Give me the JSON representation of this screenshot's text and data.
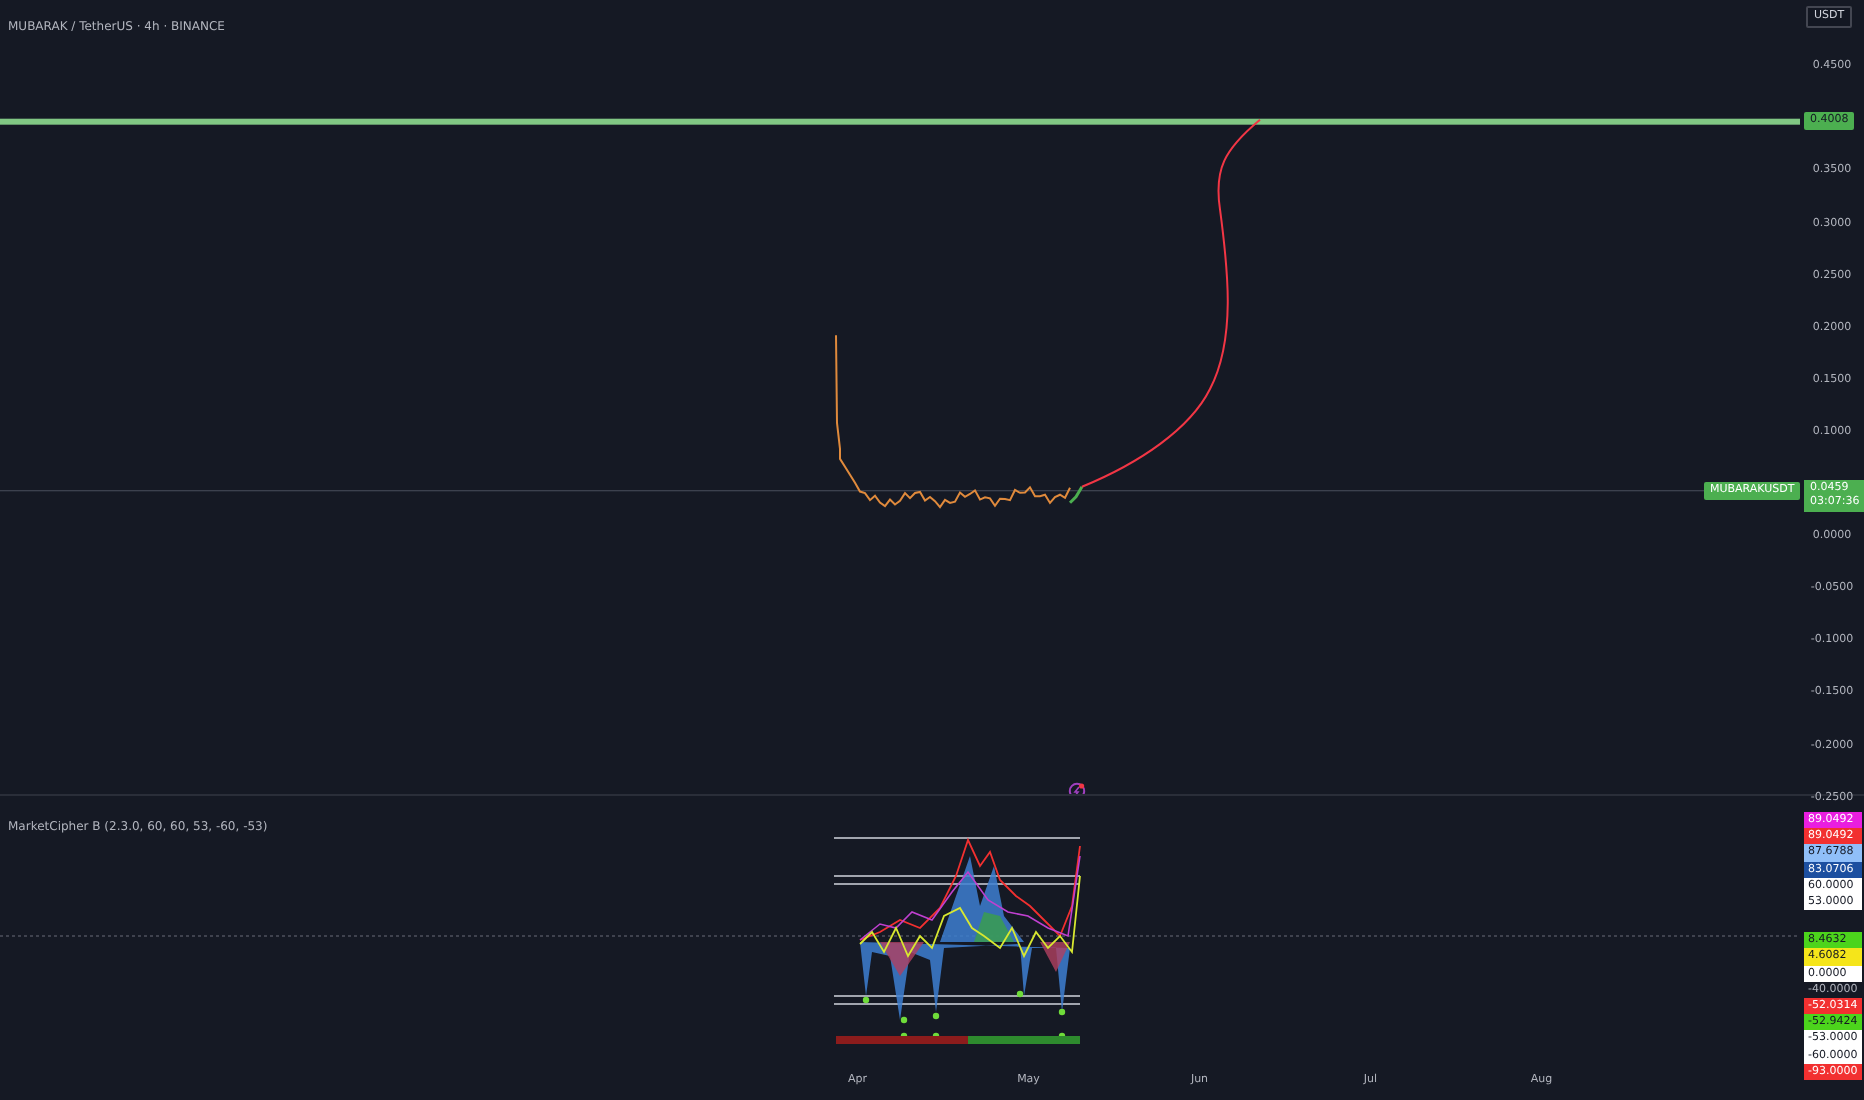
{
  "chart": {
    "legend": "MUBARAK / TetherUS · 4h · BINANCE",
    "symbol_label": "MUBARAKUSDT",
    "line_price": "0.4008",
    "last_price": "0.0459",
    "countdown": "03:07:36"
  },
  "price_axis": {
    "currency": "USDT",
    "tick_groups": [
      [
        "0.4500"
      ],
      [
        "0.3500",
        "0.3000",
        "0.2500",
        "0.2000",
        "0.1500",
        "0.1000"
      ],
      [
        "0.0000",
        "-0.0500",
        "-0.1000",
        "-0.1500",
        "-0.2000",
        "-0.2500"
      ]
    ]
  },
  "indicator": {
    "legend": "MarketCipher B (2.3.0, 60, 60, 53, -60, -53)",
    "upper_labels": [
      {
        "value": "89.0492",
        "color": "#e91ee0"
      },
      {
        "value": "89.0492",
        "color": "#f23030"
      },
      {
        "value": "87.6788",
        "color": "#90bff9"
      },
      {
        "value": "83.0706",
        "color": "#1c4fa0"
      },
      {
        "value": "60.0000",
        "color": "#ffffff"
      },
      {
        "value": "53.0000",
        "color": "#ffffff"
      }
    ],
    "lower_labels": [
      {
        "value": "8.4632",
        "color": "#4cd41c"
      },
      {
        "value": "4.6082",
        "color": "#f5e51a"
      },
      {
        "value": "0.0000",
        "color": "#ffffff"
      },
      {
        "value": "-40.0000"
      },
      {
        "value": "-52.0314",
        "color": "#f23030"
      },
      {
        "value": "-52.9424",
        "color": "#4cd41c"
      },
      {
        "value": "-53.0000",
        "color": "#ffffff"
      },
      {
        "value": "-60.0000",
        "color": "#ffffff"
      },
      {
        "value": "-93.0000",
        "color": "#f23030"
      }
    ]
  },
  "time_axis": [
    "Apr",
    "May",
    "Jun",
    "Jul",
    "Aug"
  ]
}
